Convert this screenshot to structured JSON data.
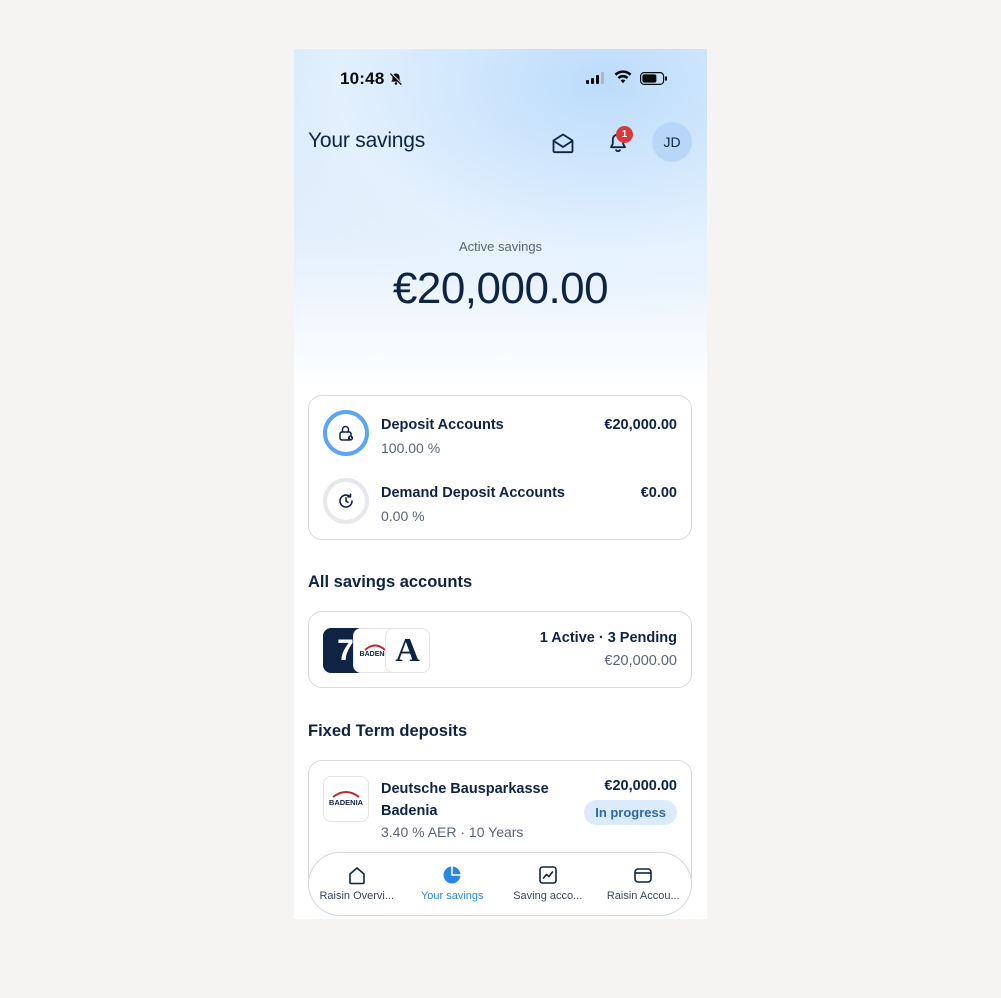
{
  "status_bar": {
    "time": "10:48"
  },
  "header": {
    "title": "Your savings",
    "notification_count": "1",
    "avatar_initials": "JD"
  },
  "hero": {
    "label": "Active savings",
    "amount": "€20,000.00"
  },
  "summary": {
    "rows": [
      {
        "name": "Deposit Accounts",
        "percent": "100.00 %",
        "amount": "€20,000.00",
        "fill": 1.0
      },
      {
        "name": "Demand Deposit Accounts",
        "percent": "0.00 %",
        "amount": "€0.00",
        "fill": 0.0
      }
    ]
  },
  "all_accounts": {
    "title": "All savings accounts",
    "status": "1 Active · 3 Pending",
    "amount": "€20,000.00",
    "logos": [
      "7",
      "BADENIA",
      "A"
    ]
  },
  "fixed_term": {
    "title": "Fixed Term deposits",
    "bank_name": "Deutsche Bausparkasse Badenia",
    "logo_text": "BADENIA",
    "detail": "3.40 % AER · 10 Years",
    "amount": "€20,000.00",
    "status_badge": "In progress"
  },
  "tabs": [
    {
      "label": "Raisin Overvi...",
      "icon": "home-icon"
    },
    {
      "label": "Your savings",
      "icon": "pie-chart-icon",
      "active": true
    },
    {
      "label": "Saving acco...",
      "icon": "chart-line-icon"
    },
    {
      "label": "Raisin Accou...",
      "icon": "wallet-icon"
    }
  ],
  "colors": {
    "accent": "#2b86e0",
    "ring": "#5aa6f0",
    "badge_bg": "#dcebfb",
    "notification": "#d9393b",
    "text": "#0f2445"
  }
}
